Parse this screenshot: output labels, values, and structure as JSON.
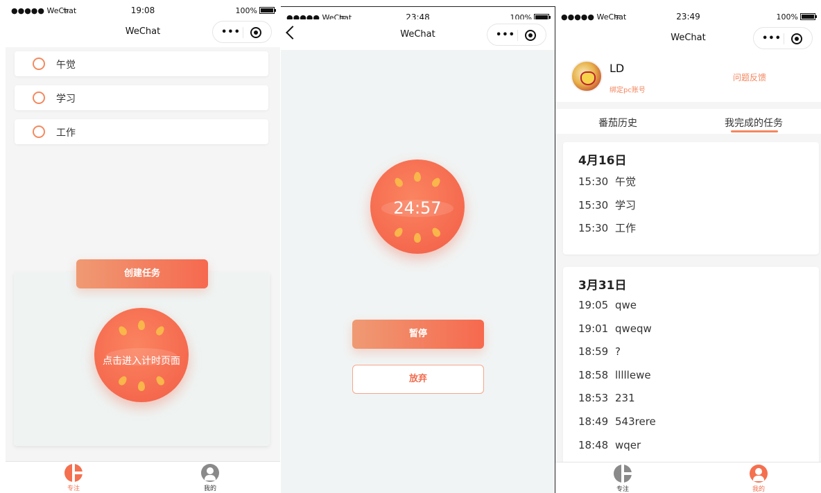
{
  "statusbar": {
    "carrier": "●●●●● WeChat",
    "battery": "100%"
  },
  "screens": {
    "s1": {
      "time": "19:08",
      "title": "WeChat",
      "tasks": [
        {
          "label": "午觉"
        },
        {
          "label": "学习"
        },
        {
          "label": "工作"
        }
      ],
      "create_button": "创建任务",
      "tomato_text": "点击进入计时页面"
    },
    "s2": {
      "time": "23:48",
      "title": "WeChat",
      "timer": "24:57",
      "pause_button": "暂停",
      "abandon_button": "放弃"
    },
    "s3": {
      "time": "23:49",
      "title": "WeChat",
      "username": "LD",
      "bind_link": "绑定pc账号",
      "feedback_link": "问题反馈",
      "tabs": [
        {
          "label": "番茄历史"
        },
        {
          "label": "我完成的任务"
        }
      ],
      "days": [
        {
          "date": "4月16日",
          "entries": [
            {
              "time": "15:30",
              "task": "午觉"
            },
            {
              "time": "15:30",
              "task": "学习"
            },
            {
              "time": "15:30",
              "task": "工作"
            }
          ]
        },
        {
          "date": "3月31日",
          "entries": [
            {
              "time": "19:05",
              "task": "qwe"
            },
            {
              "time": "19:01",
              "task": "qweqw"
            },
            {
              "time": "18:59",
              "task": "?"
            },
            {
              "time": "18:58",
              "task": "lllllewe"
            },
            {
              "time": "18:53",
              "task": "231"
            },
            {
              "time": "18:49",
              "task": "543rere"
            },
            {
              "time": "18:48",
              "task": "wqer"
            }
          ]
        }
      ]
    }
  },
  "tabbar": {
    "focus": "专注",
    "mine": "我的"
  },
  "colors": {
    "accent": "#f4704f",
    "accent_light": "#ef9a73",
    "inactive": "#8a8a8a"
  },
  "icons": [
    "wifi-icon",
    "battery-icon",
    "more-dots-icon",
    "target-icon",
    "back-icon",
    "focus-icon",
    "person-icon",
    "tomato-icon"
  ]
}
